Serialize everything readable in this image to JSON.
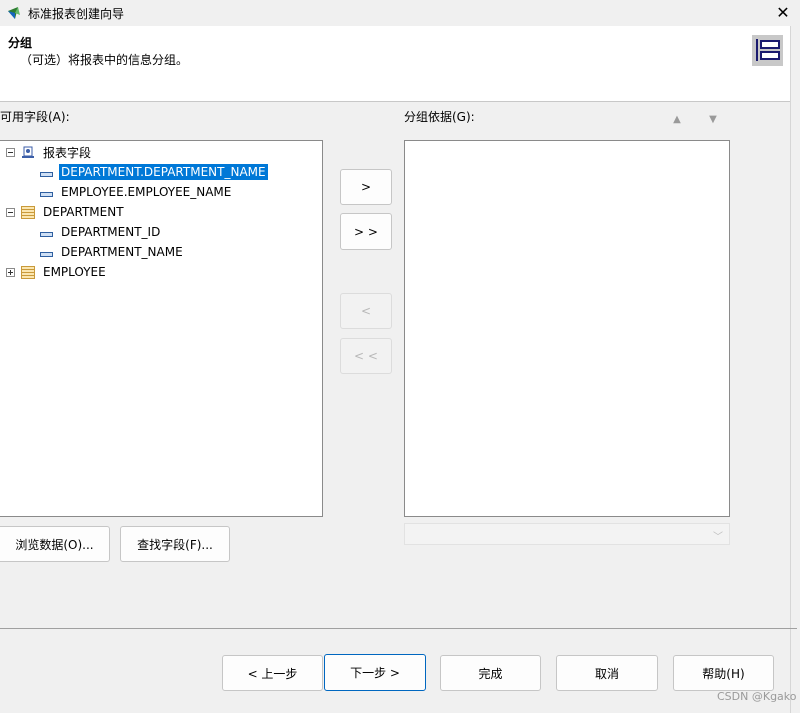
{
  "window": {
    "title": "标准报表创建向导",
    "close_icon": "close-icon"
  },
  "header": {
    "title": "分组",
    "description": "（可选）将报表中的信息分组。",
    "icon": "group-layout-icon"
  },
  "available": {
    "label": "可用字段(A):",
    "tree": [
      {
        "label": "报表字段",
        "icon": "report-fields-icon",
        "expander": "collapse"
      },
      {
        "label": "DEPARTMENT.DEPARTMENT_NAME",
        "icon": "field-icon",
        "selected": true
      },
      {
        "label": "EMPLOYEE.EMPLOYEE_NAME",
        "icon": "field-icon"
      },
      {
        "label": "DEPARTMENT",
        "icon": "table-icon",
        "expander": "collapse"
      },
      {
        "label": "DEPARTMENT_ID",
        "icon": "field-icon"
      },
      {
        "label": "DEPARTMENT_NAME",
        "icon": "field-icon"
      },
      {
        "label": "EMPLOYEE",
        "icon": "table-icon",
        "expander": "expand"
      }
    ]
  },
  "move_buttons": {
    "add": ">",
    "add_all": "> >",
    "remove": "<",
    "remove_all": "< <"
  },
  "group_by": {
    "label": "分组依据(G):",
    "items": [],
    "combo_value": ""
  },
  "actions": {
    "browse": "浏览数据(O)...",
    "find": "查找字段(F)..."
  },
  "footer": {
    "back": "< 上一步",
    "next": "下一步 >",
    "finish": "完成",
    "cancel": "取消",
    "help": "帮助(H)"
  },
  "watermark": "CSDN @Kgako"
}
